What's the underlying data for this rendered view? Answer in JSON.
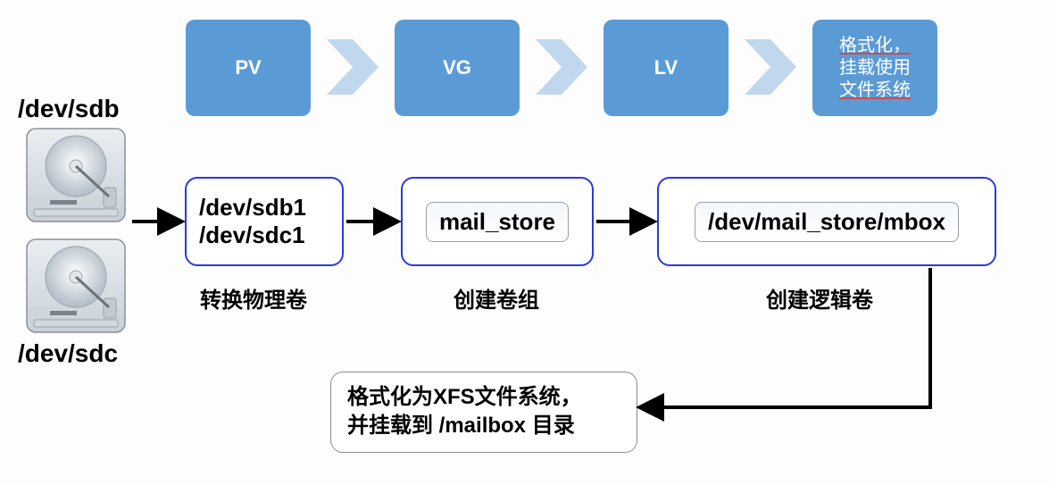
{
  "top_row": {
    "pv": "PV",
    "vg": "VG",
    "lv": "LV",
    "final_line1": "格式化，",
    "final_line2": "挂载使用",
    "final_line3": "文件系统"
  },
  "disks": {
    "top_label": "/dev/sdb",
    "bottom_label": "/dev/sdc"
  },
  "mid_row": {
    "box1_line1": "/dev/sdb1",
    "box1_line2": "/dev/sdc1",
    "box2_pill": "mail_store",
    "box3_pill": "/dev/mail_store/mbox",
    "caption1": "转换物理卷",
    "caption2": "创建卷组",
    "caption3": "创建逻辑卷"
  },
  "bottom_box": {
    "line1": "格式化为XFS文件系统，",
    "line2": "并挂载到 /mailbox 目录"
  }
}
